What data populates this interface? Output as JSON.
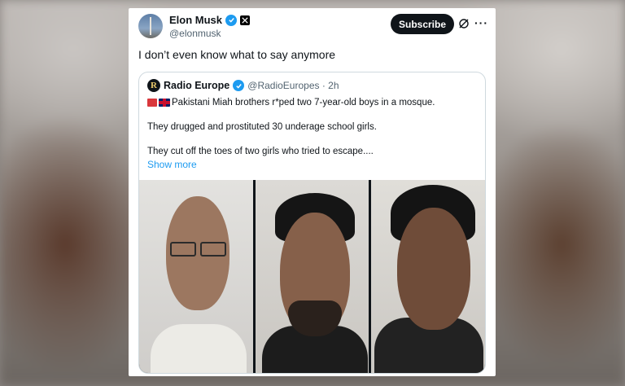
{
  "author": {
    "display_name": "Elon Musk",
    "handle": "@elonmusk",
    "verified": true
  },
  "subscribe_label": "Subscribe",
  "tweet_text": "I don’t even know what to say anymore",
  "quoted": {
    "display_name": "Radio Europe",
    "handle_time": "@RadioEuropes · 2h",
    "avatar_letter": "R",
    "line1": "Pakistani Miah brothers r*ped two 7-year-old boys in a mosque.",
    "line2": "They drugged and prostituted 30 underage school girls.",
    "line3": "They cut off the toes of two girls who tried to escape....",
    "show_more": "Show more",
    "photos": [
      "mugshot-1",
      "mugshot-2",
      "mugshot-3"
    ]
  },
  "colors": {
    "accent": "#1d9bf0",
    "text": "#0f1419",
    "muted": "#536471"
  }
}
